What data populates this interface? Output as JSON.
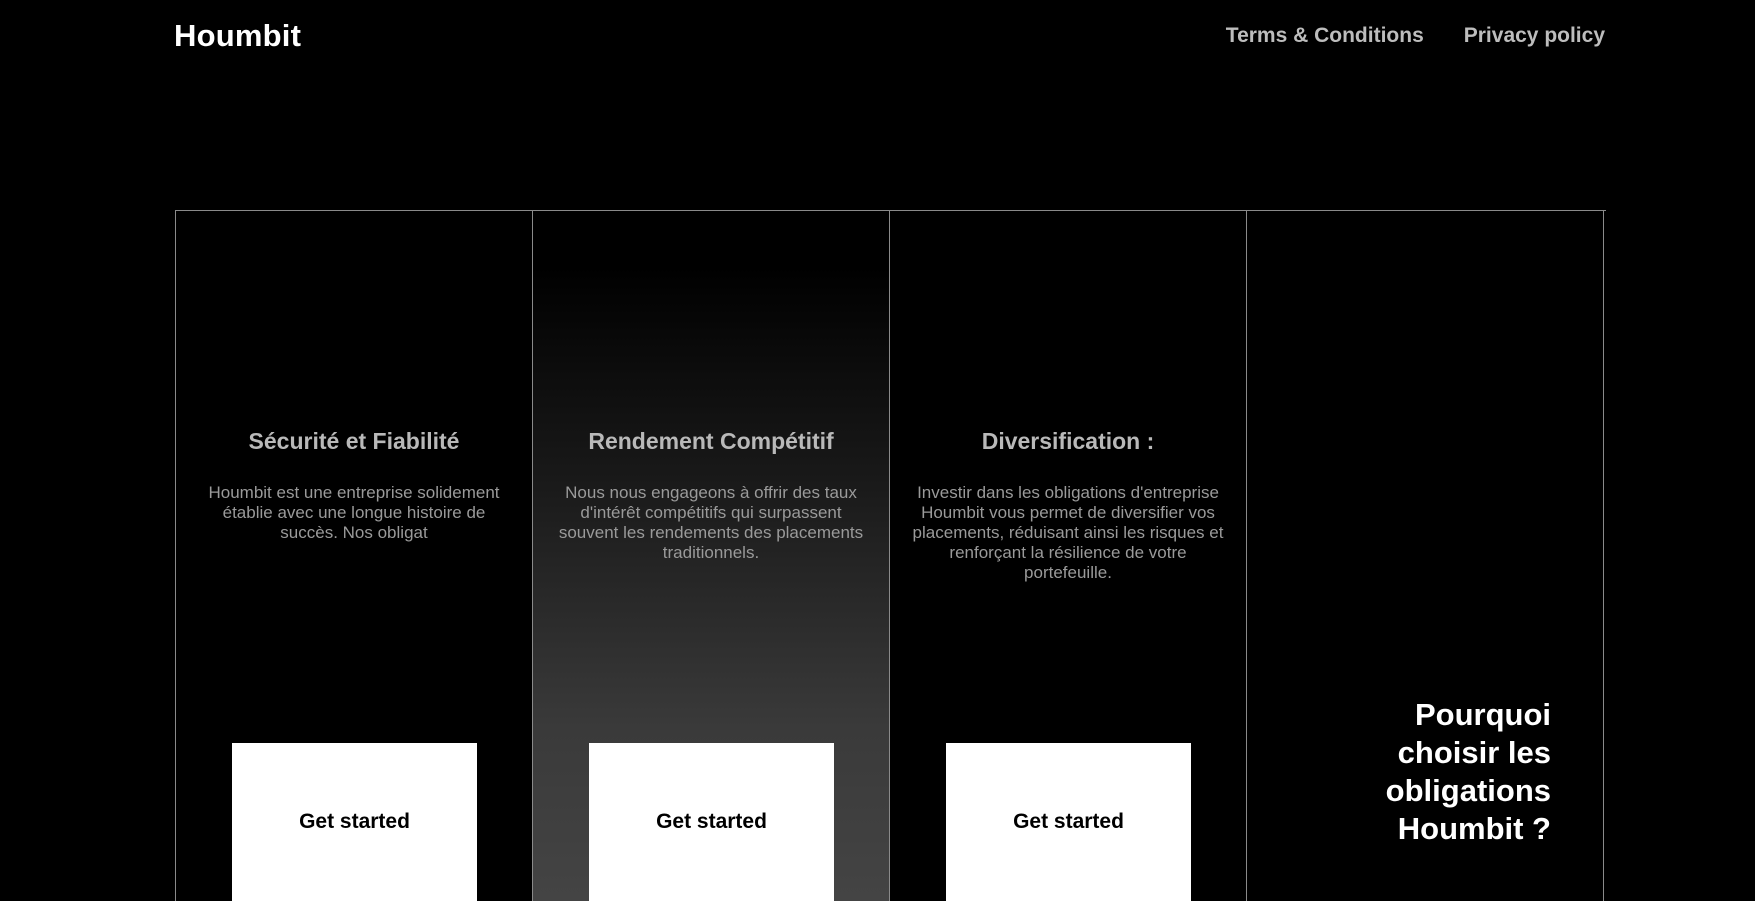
{
  "header": {
    "logo": "Houmbit",
    "nav": {
      "terms": "Terms & Conditions",
      "privacy": "Privacy policy"
    }
  },
  "cards": [
    {
      "title": "Sécurité et Fiabilité",
      "text": "Houmbit est une entreprise solidement établie avec une longue histoire de succès. Nos obligat",
      "button": "Get started"
    },
    {
      "title": "Rendement Compétitif",
      "text": "Nous nous engageons à offrir des taux d'intérêt compétitifs qui surpassent souvent les rendements des placements traditionnels.",
      "button": "Get started"
    },
    {
      "title": "Diversification :",
      "text": "Investir dans les obligations d'entreprise Houmbit vous permet de diversifier vos placements, réduisant ainsi les risques et renforçant la résilience de votre portefeuille.",
      "button": "Get started"
    }
  ],
  "why": {
    "title": "Pourquoi choisir les obligations Houmbit ?"
  },
  "colors": {
    "background": "#000000",
    "button_bg": "#ffffff",
    "border": "#8a8a8a",
    "muted_text": "#9a9a9a"
  }
}
